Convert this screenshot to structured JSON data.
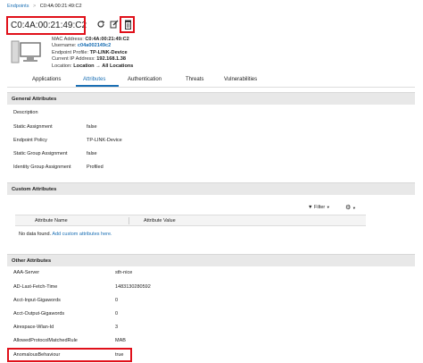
{
  "breadcrumb": {
    "root": "Endpoints",
    "separator": ">",
    "current": "C0:4A:00:21:49:C2"
  },
  "header": {
    "title": "C0:4A:00:21:49:C2",
    "details": [
      {
        "label": "MAC Address:",
        "value": "C0:4A:00:21:49:C2"
      },
      {
        "label": "Username:",
        "value": "c04a002149c2"
      },
      {
        "label": "Endpoint Profile:",
        "value": "TP-LINK-Device"
      },
      {
        "label": "Current IP Address:",
        "value": "192.168.1.38"
      },
      {
        "label": "Location:",
        "value": "Location",
        "arrow": "→",
        "value2": "All Locations"
      }
    ]
  },
  "tabs": [
    {
      "label": "Applications",
      "active": false
    },
    {
      "label": "Attributes",
      "active": true
    },
    {
      "label": "Authentication",
      "active": false
    },
    {
      "label": "Threats",
      "active": false
    },
    {
      "label": "Vulnerabilities",
      "active": false
    }
  ],
  "general": {
    "title": "General Attributes",
    "rows": [
      {
        "label": "Description",
        "value": ""
      },
      {
        "label": "Static Assignment",
        "value": "false"
      },
      {
        "label": "Endpoint Policy",
        "value": "TP-LINK-Device"
      },
      {
        "label": "Static Group Assignment",
        "value": "false"
      },
      {
        "label": "Identity Group Assignment",
        "value": "Profiled"
      }
    ]
  },
  "custom": {
    "title": "Custom Attributes",
    "filter_label": "Filter",
    "columns": [
      "Attribute Name",
      "Attribute Value"
    ],
    "empty_text": "No data found.",
    "add_link": "Add custom attributes here."
  },
  "other": {
    "title": "Other Attributes",
    "rows": [
      {
        "label": "AAA-Server",
        "value": "sth-nice"
      },
      {
        "label": "AD-Last-Fetch-Time",
        "value": "1483130280592"
      },
      {
        "label": "Acct-Input-Gigawords",
        "value": "0"
      },
      {
        "label": "Acct-Output-Gigawords",
        "value": "0"
      },
      {
        "label": "Airespace-Wlan-Id",
        "value": "3"
      },
      {
        "label": "AllowedProtocolMatchedRule",
        "value": "MAB"
      },
      {
        "label": "AnomalousBehaviour",
        "value": "true"
      }
    ]
  },
  "colors": {
    "accent": "#1a6fb4",
    "highlight": "#e0101a"
  }
}
